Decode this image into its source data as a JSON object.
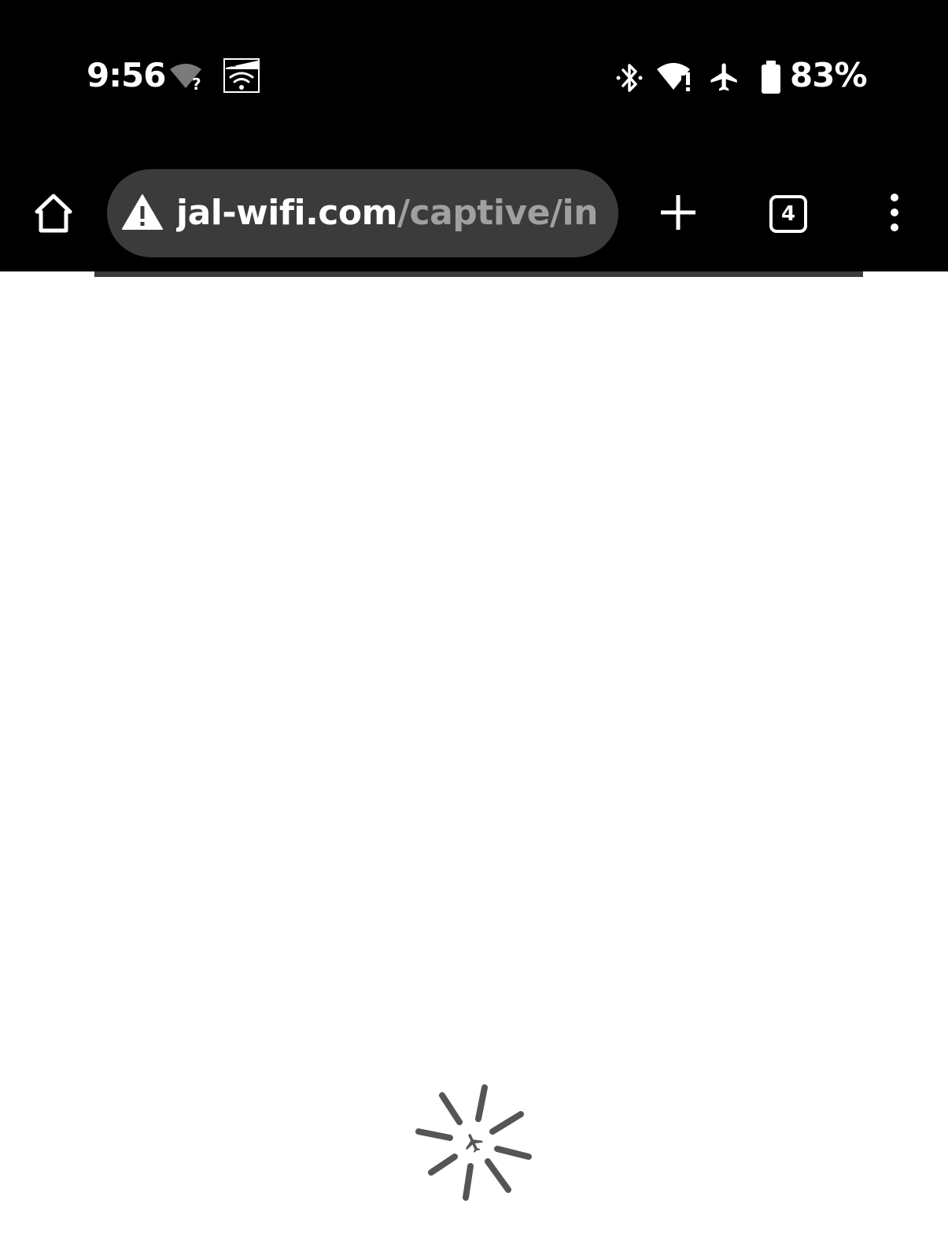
{
  "status_bar": {
    "time": "9:56",
    "battery_percent": "83%",
    "icons": [
      "wifi-unknown-icon",
      "au-wifi-icon",
      "bluetooth-icon",
      "wifi-alert-icon",
      "airplane-mode-icon",
      "battery-icon"
    ]
  },
  "toolbar": {
    "home_icon": "home-icon",
    "security_icon": "warning-icon",
    "url_host": "jal-wifi.com",
    "url_path": "/captive/in",
    "new_tab_icon": "plus-icon",
    "tab_count": "4",
    "menu_icon": "more-vert-icon"
  },
  "page": {
    "loading_progress": 0.9,
    "loader_icon": "airplane-spinner-icon"
  },
  "colors": {
    "chrome_background": "#000000",
    "omnibox_background": "#3b3b3b",
    "url_path_color": "#a0a0a0",
    "spinner_color": "#555555"
  }
}
